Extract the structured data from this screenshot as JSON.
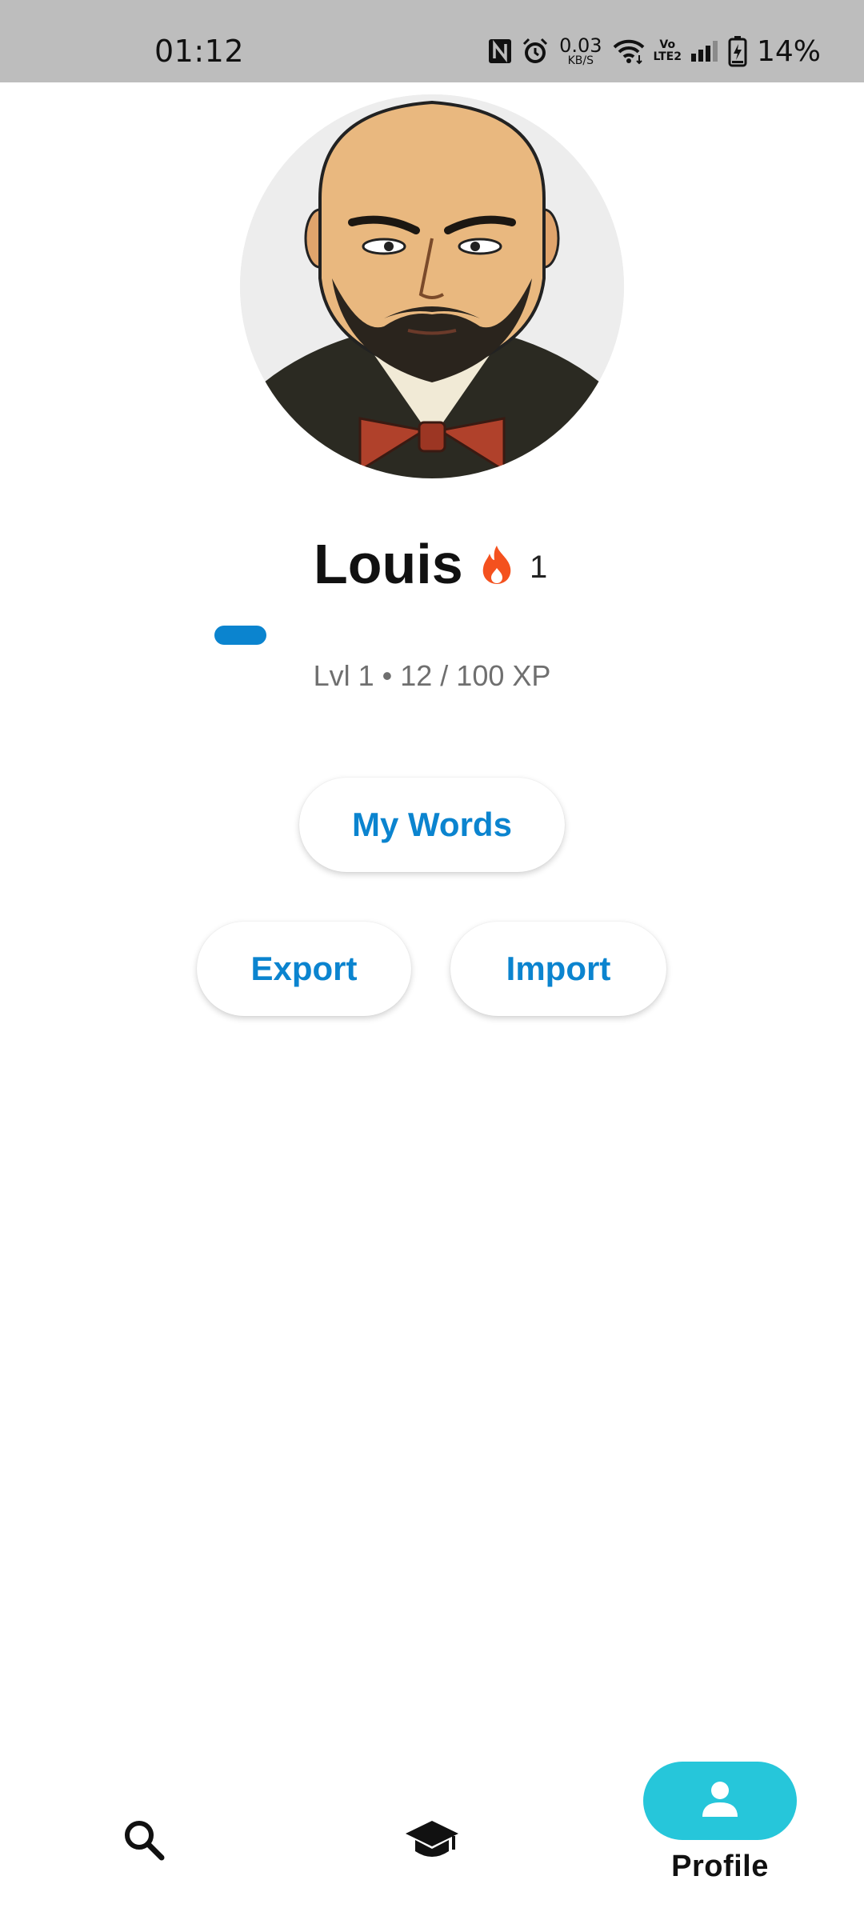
{
  "status_bar": {
    "time": "01:12",
    "net_speed_value": "0.03",
    "net_speed_unit": "KB/S",
    "volte_top": "Vo",
    "volte_bottom": "LTE2",
    "battery_percent": "14%"
  },
  "profile": {
    "name": "Louis",
    "streak_count": "1",
    "xp_progress_fraction": 0.12,
    "xp_text": "Lvl 1 • 12 / 100 XP"
  },
  "actions": {
    "my_words_label": "My Words",
    "export_label": "Export",
    "import_label": "Import"
  },
  "bottom_nav": {
    "items": [
      {
        "icon": "search-icon",
        "label": "",
        "active": false
      },
      {
        "icon": "graduation-cap-icon",
        "label": "",
        "active": false
      },
      {
        "icon": "person-icon",
        "label": "Profile",
        "active": true
      }
    ]
  },
  "colors": {
    "accent": "#0b84cf",
    "nav_active": "#26c6da",
    "streak_flame": "#f4511e",
    "status_bar_bg": "#bdbdbd"
  }
}
